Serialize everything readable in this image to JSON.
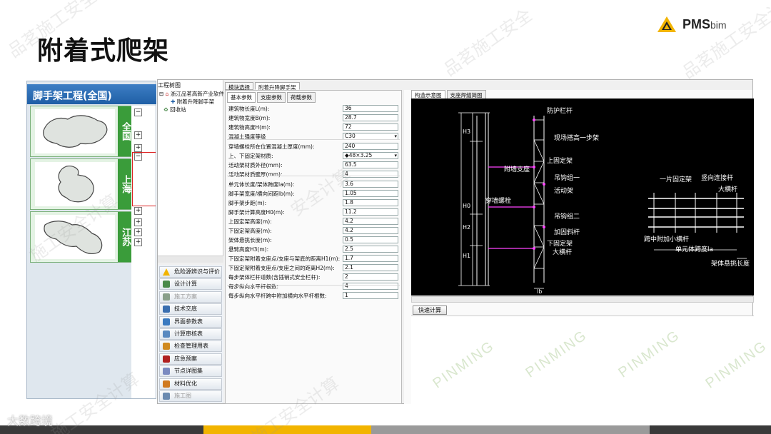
{
  "slide": {
    "title": "附着式爬架",
    "logo": {
      "brand": "PMS",
      "sub": "bim"
    },
    "watermarks": [
      "品茗施工安全",
      "品茗施工安全",
      "安全计算",
      "施工安全计算",
      "品茗施工安全计算",
      "施工安全计算",
      "施工安全计算"
    ],
    "watermark_en": [
      "PINMING",
      "PINMING",
      "PINMING",
      "PINMING"
    ],
    "corner_logo": "大数跨境",
    "bottom_colors": [
      "#3a3a3a",
      "#f2b400",
      "#9a9a9a",
      "#3a3a3a"
    ]
  },
  "left_panel": {
    "header": "脚手架工程(全国)",
    "cards": [
      {
        "label": "全国",
        "map_icon": "china-map"
      },
      {
        "label": "上海",
        "map_icon": "shanghai-map"
      },
      {
        "label": "江苏",
        "map_icon": "jiangsu-map"
      }
    ]
  },
  "app": {
    "tree": {
      "title": "工程树图",
      "root": "浙江品茗高新产业软件",
      "child": "附着升降脚手架",
      "recycle": "回收站"
    },
    "top_tabs": [
      "模块选择",
      "附着升降脚手架"
    ],
    "sub_tabs": [
      "基本参数",
      "支座参数",
      "荷载参数"
    ],
    "params": [
      {
        "label": "建筑物长度L(m):",
        "value": "36"
      },
      {
        "label": "建筑物宽度B(m):",
        "value": "28.7"
      },
      {
        "label": "建筑物高度H(m):",
        "value": "72"
      },
      {
        "label": "混凝土强度等级",
        "value": "C30",
        "dropdown": true
      },
      {
        "label": "穿墙螺栓所在位置混凝土厚度(mm):",
        "value": "240"
      },
      {
        "label": "上、下固定架材质:",
        "value": "◆48×3.25",
        "dropdown": true
      },
      {
        "label": "活动架材质外径(mm):",
        "value": "63.5"
      },
      {
        "label": "活动架材质壁厚(mm):",
        "value": "4"
      },
      {
        "label": "单元体长度/架体跨度la(m):",
        "value": "3.6"
      },
      {
        "label": "脚手架宽度/横向间距lb(m):",
        "value": "1.05"
      },
      {
        "label": "脚手架步距(m):",
        "value": "1.8"
      },
      {
        "label": "脚手架计算高度H0(m):",
        "value": "11.2"
      },
      {
        "label": "上固定架高度(m):",
        "value": "4.2"
      },
      {
        "label": "下固定架高度(m):",
        "value": "4.2"
      },
      {
        "label": "架体悬挑长度(m):",
        "value": "0.5"
      },
      {
        "label": "悬臂高度H3(m):",
        "value": "2.5"
      },
      {
        "label": "下固定架附着支座点/支座与架底的距离H1(m):",
        "value": "1.7"
      },
      {
        "label": "下固定架附着支座点/支座之间的距离H2(m):",
        "value": "2.1"
      },
      {
        "label": "每步架体栏杆道数(含插销式安全栏杆):",
        "value": "2"
      },
      {
        "label": "每步纵向水平杆根数:",
        "value": "4"
      },
      {
        "label": "每步纵向水平杆跨中附加横向水平杆根数:",
        "value": "1"
      }
    ],
    "nav_buttons": [
      {
        "label": "危险源辨识与评价",
        "icon": "warning-icon",
        "color": "#f2b400",
        "disabled": false
      },
      {
        "label": "设计计算",
        "icon": "calculator-icon",
        "color": "#4a8a4a",
        "disabled": false
      },
      {
        "label": "施工方案",
        "icon": "document-icon",
        "color": "#8aa08a",
        "disabled": true
      },
      {
        "label": "技术交底",
        "icon": "person-icon",
        "color": "#3a6fb0",
        "disabled": false
      },
      {
        "label": "界面参数表",
        "icon": "table-icon",
        "color": "#3a7ac0",
        "disabled": false
      },
      {
        "label": "计算审核表",
        "icon": "checklist-icon",
        "color": "#5a8ac0",
        "disabled": false
      },
      {
        "label": "检查管理用表",
        "icon": "clipboard-icon",
        "color": "#d08a20",
        "disabled": false
      },
      {
        "label": "应急预案",
        "icon": "book-icon",
        "color": "#b02020",
        "disabled": false
      },
      {
        "label": "节点详图集",
        "icon": "gallery-icon",
        "color": "#7a8ac0",
        "disabled": false
      },
      {
        "label": "材料优化",
        "icon": "pencil-icon",
        "color": "#d07a20",
        "disabled": false
      },
      {
        "label": "施工图",
        "icon": "drawing-icon",
        "color": "#6a8ab0",
        "disabled": true
      }
    ],
    "right_tabs": [
      "构造示意图",
      "支座焊缝简图"
    ],
    "quick_calc": "快速计算",
    "drawing": {
      "left_labels": [
        "防护栏杆",
        "现场搭高一步架",
        "上固定架",
        "附墙支座",
        "吊钩组一",
        "活动架",
        "穿墙螺栓",
        "吊钩组二",
        "加固斜杆",
        "下固定架",
        "大横杆"
      ],
      "dim_labels": [
        "H3",
        "H0",
        "H2",
        "H1",
        "lb"
      ],
      "right_labels": [
        "一片固定架",
        "竖向连接杆",
        "大横杆",
        "跨中附加小横杆",
        "单元体跨度la",
        "架体悬挑长度"
      ]
    }
  }
}
